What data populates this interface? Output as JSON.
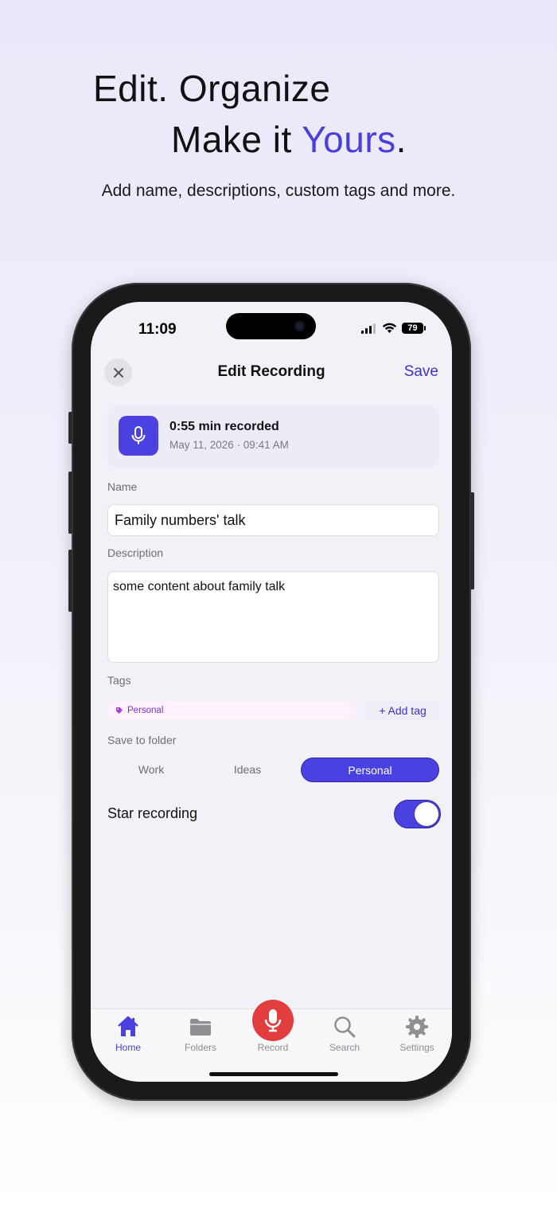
{
  "promo": {
    "headline_line1": "Edit. Organize",
    "headline_line2_prefix": "Make it ",
    "headline_line2_accent": "Yours",
    "headline_line2_suffix": ".",
    "subtitle": "Add name, descriptions, custom tags and more."
  },
  "status_bar": {
    "time": "11:09",
    "battery": "79"
  },
  "nav": {
    "title": "Edit Recording",
    "save_label": "Save",
    "close_icon": "close-icon"
  },
  "recording": {
    "duration_text": "0:55 min recorded",
    "date_text": "May 11, 2026 · 09:41 AM",
    "icon": "microphone-icon"
  },
  "form": {
    "name_label": "Name",
    "name_value": "Family numbers' talk",
    "description_label": "Description",
    "description_value": "some content about family talk",
    "tags_label": "Tags",
    "tags": [
      "Personal"
    ],
    "add_tag_label": "+ Add tag",
    "folder_label": "Save to folder",
    "folders": [
      "Work",
      "Ideas",
      "Personal"
    ],
    "selected_folder": "Personal",
    "star_label": "Star recording",
    "star_on": true
  },
  "tabbar": {
    "items": [
      {
        "label": "Home",
        "icon": "home-icon",
        "active": true
      },
      {
        "label": "Folders",
        "icon": "folder-icon",
        "active": false
      },
      {
        "label": "Record",
        "icon": "microphone-icon",
        "active": false
      },
      {
        "label": "Search",
        "icon": "search-icon",
        "active": false
      },
      {
        "label": "Settings",
        "icon": "gear-icon",
        "active": false
      }
    ]
  },
  "colors": {
    "accent": "#4a41e0",
    "record_red": "#e33e3e",
    "tag_purple": "#8b2fc7"
  }
}
